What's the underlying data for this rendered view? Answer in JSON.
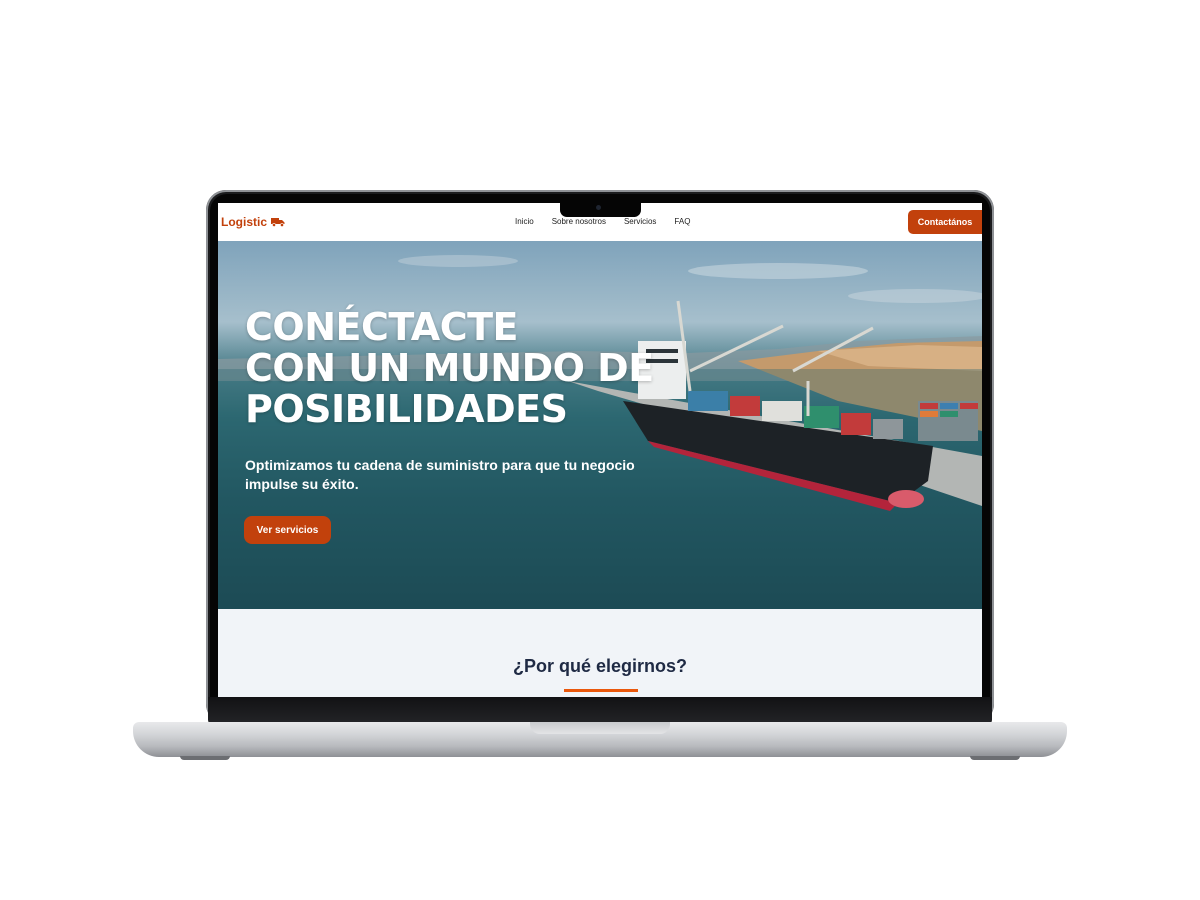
{
  "nav": {
    "logo_text": "Logistic",
    "logo_icon": "truck-icon",
    "menu": [
      "Inicio",
      "Sobre nosotros",
      "Servicios",
      "FAQ"
    ],
    "cta_label": "Contactános"
  },
  "hero": {
    "title_lines": [
      "CONÉCTACTE",
      "CON UN MUNDO DE",
      "POSIBILIDADES"
    ],
    "subtitle": "Optimizamos tu cadena de suministro para que tu negocio impulse su éxito.",
    "button_label": "Ver servicios"
  },
  "why": {
    "title": "¿Por qué elegirnos?"
  },
  "colors": {
    "accent": "#c2410c",
    "underline": "#ea580c",
    "heading_dark": "#1f2a44",
    "section_bg": "#f1f4f8"
  }
}
